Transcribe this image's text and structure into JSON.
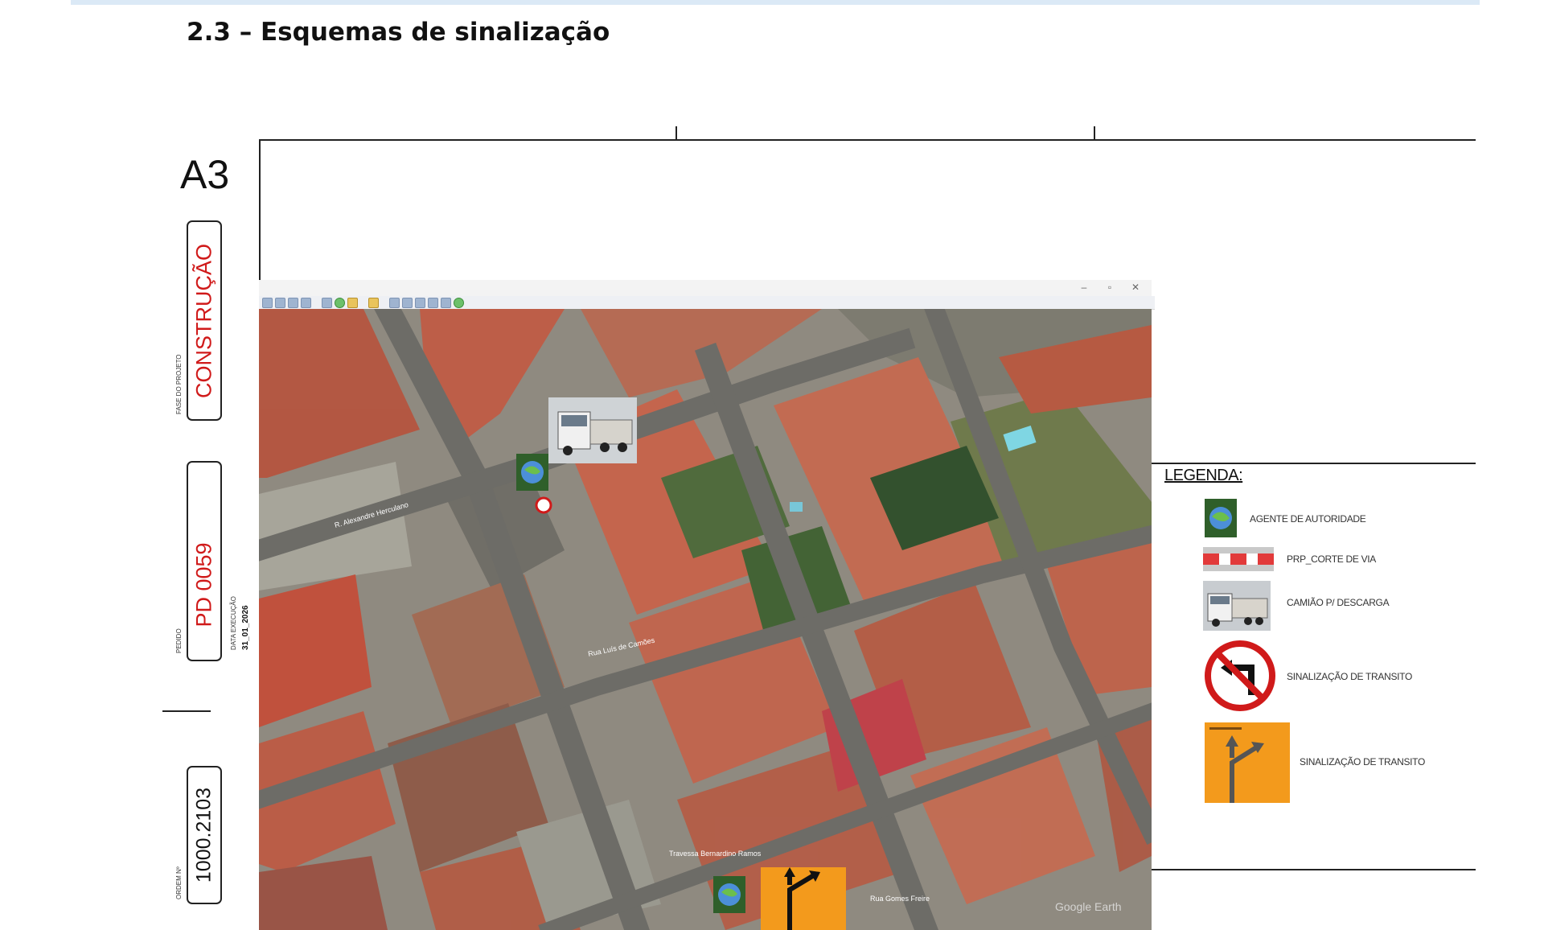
{
  "section": {
    "title": "2.3 – Esquemas de sinalização"
  },
  "title_block": {
    "sheet_size": "A3",
    "fase_label": "FASE DO PROJETO",
    "fase_value": "CONSTRUÇÃO",
    "pedido_label": "PEDIDO",
    "pedido_value": "PD 0059",
    "data_label": "DATA EXECUÇÃO",
    "data_value": "31_01_2026",
    "ordem_label": "ORDEM Nº",
    "ordem_value": "1000.2103"
  },
  "map": {
    "window_controls": [
      "–",
      "▫",
      "✕"
    ],
    "street_left": "R. Alexandre Herculano",
    "street_center": "Rua Luís de Camões",
    "street_bottom": "Travessa Bernardino Ramos",
    "poi_bottom": "Rua Gomes Freire",
    "watermark": "Google Earth"
  },
  "legend": {
    "title": "LEGENDA:",
    "items": [
      {
        "icon": "globe-agent-icon",
        "label": "AGENTE DE AUTORIDADE"
      },
      {
        "icon": "barrier-icon",
        "label": "PRP_CORTE DE VIA"
      },
      {
        "icon": "truck-icon",
        "label": "CAMIÃO P/ DESCARGA"
      },
      {
        "icon": "no-left-turn-sign-icon",
        "label": "SINALIZAÇÃO DE TRANSITO"
      },
      {
        "icon": "direction-sign-icon",
        "label": "SINALIZAÇÃO DE TRANSITO"
      }
    ]
  },
  "colors": {
    "accent_red": "#d01a1a",
    "sign_orange": "#f39a1c",
    "top_band": "#dbe9f6"
  }
}
